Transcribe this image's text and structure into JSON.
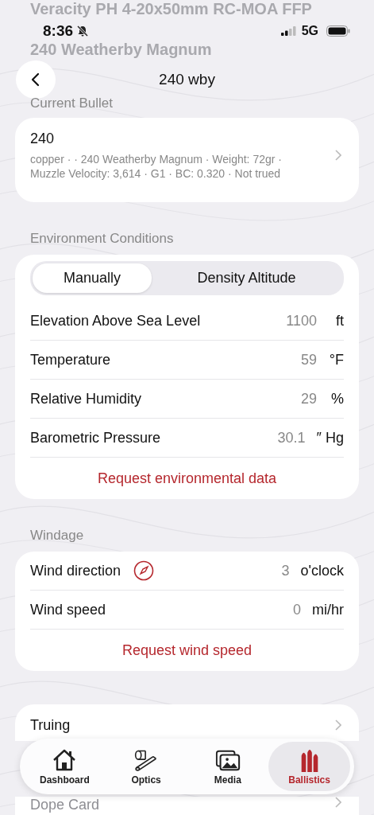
{
  "scrolled_header": [
    "Veracity PH 4-20x50mm RC-MOA FFP",
    "240 Weatherby Magnum"
  ],
  "status_bar": {
    "time": "8:36",
    "silent": true,
    "network": "5G"
  },
  "nav": {
    "title": "240 wby"
  },
  "bullet_section": {
    "heading": "Current Bullet",
    "name": "240",
    "details": [
      "copper · · 240 Weatherby Magnum · Weight: 72gr ·",
      "Muzzle Velocity: 3,614 · G1 · BC: 0.320 · Not trued"
    ]
  },
  "environment": {
    "heading": "Environment Conditions",
    "segments": [
      {
        "label": "Manually",
        "selected": true
      },
      {
        "label": "Density Altitude",
        "selected": false
      }
    ],
    "rows": [
      {
        "kind": "plain",
        "label": "Elevation Above Sea Level",
        "value": "1100",
        "unit": "ft"
      },
      {
        "kind": "plain",
        "label": "Temperature",
        "value": "59",
        "unit": "°F"
      },
      {
        "kind": "plain",
        "label": "Relative Humidity",
        "value": "29",
        "unit": "%"
      },
      {
        "kind": "plain",
        "label": "Barometric Pressure",
        "value": "30.1",
        "unit": "″ Hg"
      }
    ],
    "action": "Request environmental data"
  },
  "windage": {
    "heading": "Windage",
    "rows": [
      {
        "kind": "compass",
        "label": "Wind direction",
        "value": "3",
        "unit": "o'clock"
      },
      {
        "kind": "plain",
        "label": "Wind speed",
        "value": "0",
        "unit": "mi/hr"
      }
    ],
    "action": "Request wind speed"
  },
  "links": [
    {
      "label": "Truing"
    },
    {
      "label": "Dope Card"
    }
  ],
  "tab_bar": [
    {
      "kind": "house",
      "label": "Dashboard",
      "selected": false
    },
    {
      "kind": "scope",
      "label": "Optics",
      "selected": false
    },
    {
      "kind": "photos",
      "label": "Media",
      "selected": false
    },
    {
      "kind": "bullets",
      "label": "Ballistics",
      "selected": true
    }
  ]
}
